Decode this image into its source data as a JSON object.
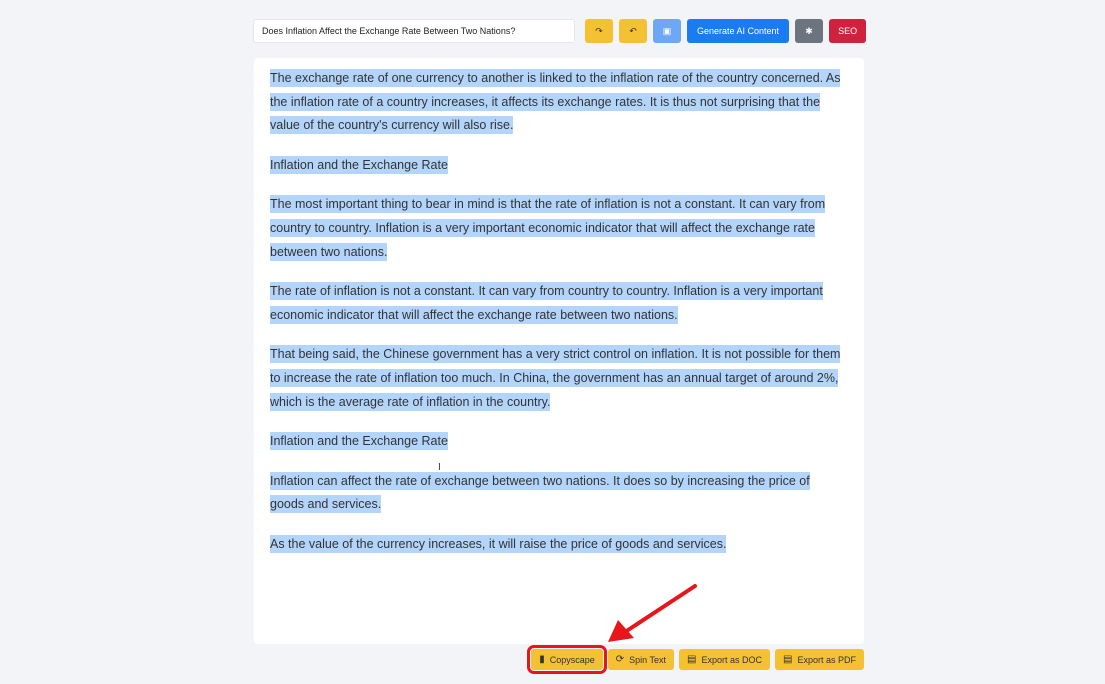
{
  "toolbar": {
    "title_value": "Does Inflation Affect the Exchange Rate Between Two Nations?",
    "redo_icon": "redo-icon",
    "undo_icon": "undo-icon",
    "save_icon": "save-icon",
    "generate_label": "Generate AI Content",
    "settings_icon": "gear-icon",
    "seo_label": "SEO"
  },
  "content": {
    "paragraphs": [
      "The exchange rate of one currency to another is linked to the inflation rate of the country concerned. As the inflation rate of a country increases, it affects its exchange rates. It is thus not surprising that the value of the country's currency will also rise.",
      "Inflation and the Exchange Rate",
      "The most important thing to bear in mind is that the rate of inflation is not a constant. It can vary from country to country. Inflation is a very important economic indicator that will affect the exchange rate between two nations.",
      "The rate of inflation is not a constant. It can vary from country to country. Inflation is a very important economic indicator that will affect the exchange rate between two nations.",
      "That being said, the Chinese government has a very strict control on inflation. It is not possible for them to increase the rate of inflation too much. In China, the government has an annual target of around 2%, which is the average rate of inflation in the country.",
      "Inflation and the Exchange Rate",
      "Inflation can affect the rate of exchange between two nations. It does so by increasing the price of goods and services.",
      "As the value of the currency increases, it will raise the price of goods and services."
    ],
    "selection_color": "#b4d5fb"
  },
  "bottom": {
    "copyscape_label": "Copyscape",
    "spin_label": "Spin Text",
    "doc_label": "Export as DOC",
    "pdf_label": "Export as PDF"
  },
  "annotation_color": "#e8151b"
}
